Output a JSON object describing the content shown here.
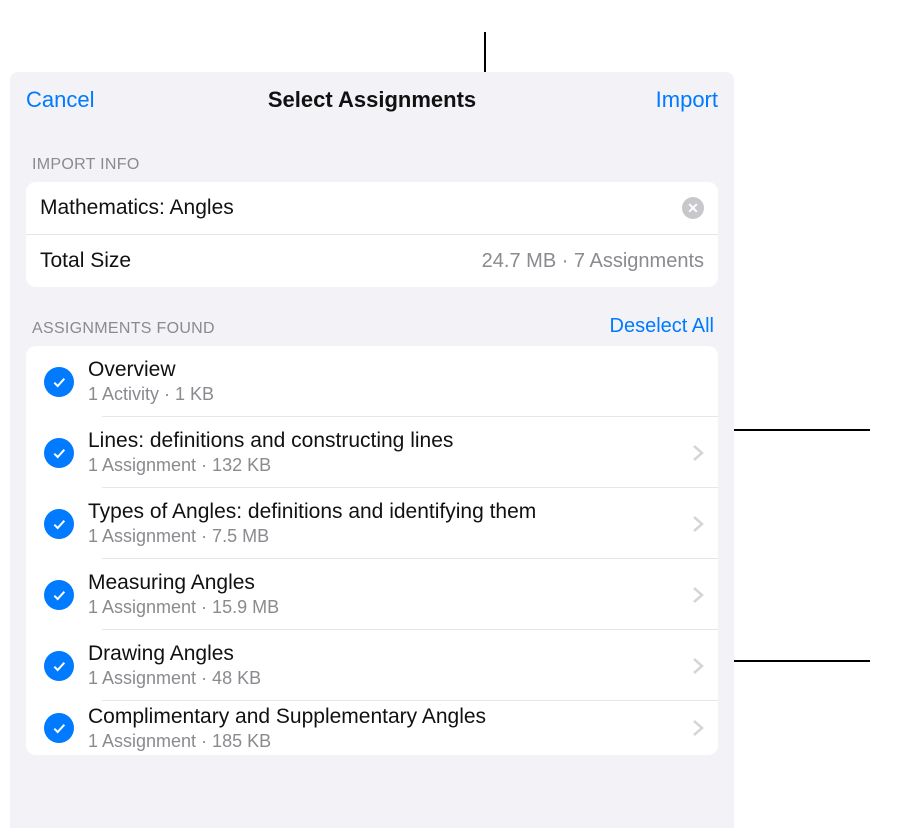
{
  "nav": {
    "cancel": "Cancel",
    "title": "Select Assignments",
    "import": "Import"
  },
  "import_info": {
    "header": "IMPORT INFO",
    "name": "Mathematics: Angles",
    "total_size_label": "Total Size",
    "total_size_value": "24.7 MB · 7 Assignments"
  },
  "assignments_section": {
    "header": "ASSIGNMENTS FOUND",
    "deselect_all": "Deselect All"
  },
  "assignments": [
    {
      "title": "Overview",
      "sub": "1 Activity · 1 KB",
      "has_detail": false
    },
    {
      "title": "Lines: definitions and constructing lines",
      "sub": "1 Assignment · 132 KB",
      "has_detail": true
    },
    {
      "title": "Types of Angles: definitions and identifying them",
      "sub": "1 Assignment · 7.5 MB",
      "has_detail": true
    },
    {
      "title": "Measuring Angles",
      "sub": "1 Assignment · 15.9 MB",
      "has_detail": true
    },
    {
      "title": "Drawing Angles",
      "sub": "1 Assignment · 48 KB",
      "has_detail": true
    },
    {
      "title": "Complimentary and Supplementary Angles",
      "sub": "1 Assignment · 185 KB",
      "has_detail": true
    }
  ]
}
